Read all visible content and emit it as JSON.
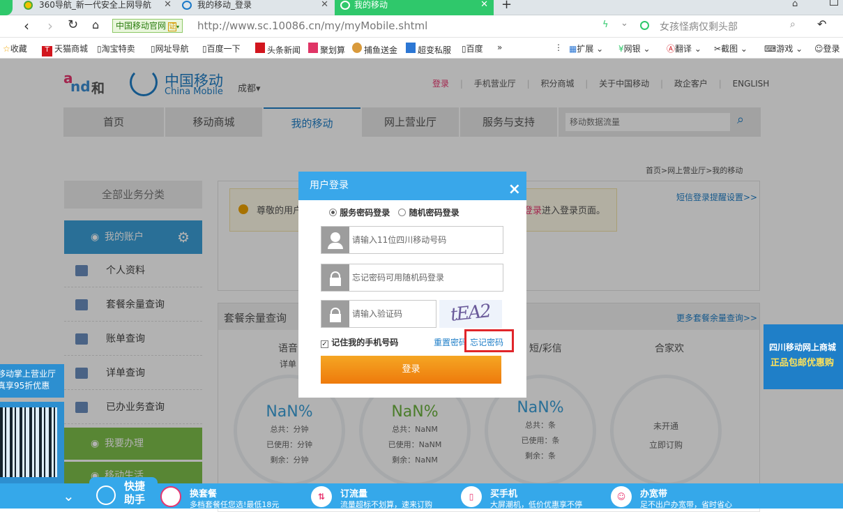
{
  "browser": {
    "tabs": [
      {
        "title": "360导航_新一代安全上网导航"
      },
      {
        "title": "我的移动_登录"
      },
      {
        "title": "我的移动"
      }
    ],
    "trusted_site_label": "中国移动官网",
    "cert_badge": "证",
    "url": "http://www.sc.10086.cn/my/myMobile.shtml",
    "search_text": "女孩怪病仅剩头部",
    "bookmarks": [
      "收藏",
      "天猫商城",
      "淘宝特卖",
      "网址导航",
      "百度一下",
      "头条新闻",
      "聚划算",
      "捕鱼送金",
      "超变私服",
      "百度"
    ],
    "more_bookmarks": "»",
    "tools": [
      "扩展",
      "网银",
      "翻译",
      "截图",
      "游戏",
      "登录"
    ]
  },
  "header": {
    "logo_he": "和",
    "logo_brand_cn": "中国移动",
    "logo_brand_en": "China Mobile",
    "city": "成都",
    "top_links": [
      "登录",
      "手机营业厅",
      "积分商城",
      "关于中国移动",
      "政企客户",
      "ENGLISH"
    ]
  },
  "nav": {
    "items": [
      "首页",
      "移动商城",
      "我的移动",
      "网上营业厅",
      "服务与支持"
    ],
    "search_placeholder": "移动数据流量"
  },
  "breadcrumb": "首页>网上营业厅>我的移动",
  "sidebar": {
    "category_title": "全部业务分类",
    "account_title": "我的账户",
    "items": [
      "个人资料",
      "套餐余量查询",
      "账单查询",
      "详单查询",
      "已办业务查询"
    ],
    "handle_title": "我要办理",
    "life_title": "移动生活"
  },
  "notice": {
    "text_start": "尊敬的用户",
    "link_text": "登录",
    "text_end": "进入登录页面。",
    "sms_reminder_link": "短信登录提醒设置>>"
  },
  "balance": {
    "title": "套餐余量查询",
    "more_link": "更多套餐余量查询>>",
    "columns": [
      "语音",
      "短/彩信",
      "合家欢"
    ],
    "voice_sub": "详单",
    "cards": [
      {
        "pct": "NaN%",
        "lines": [
          "总共：分钟",
          "已使用：分钟",
          "剩余：分钟"
        ],
        "color": "#3ba0d8"
      },
      {
        "pct": "NaN%",
        "lines": [
          "总共：NaNM",
          "已使用：NaNM",
          "剩余：NaNM"
        ],
        "color": "#6cb33e"
      },
      {
        "pct": "NaN%",
        "lines": [
          "总共：条",
          "已使用：条",
          "剩余：条"
        ],
        "color": "#3ba0d8"
      }
    ],
    "family": {
      "status": "未开通",
      "link": "立即订购"
    }
  },
  "left_promo": {
    "line1": "移动掌上营业厅",
    "line2": "真享95折优惠"
  },
  "right_promo": {
    "line1": "四川移动网上商城",
    "line2": "正品包邮优惠购"
  },
  "dialog": {
    "title": "用户登录",
    "close": "×",
    "radio_service": "服务密码登录",
    "radio_random": "随机密码登录",
    "phone_placeholder": "请输入11位四川移动号码",
    "password_placeholder": "忘记密码可用随机码登录",
    "captcha_placeholder": "请输入验证码",
    "captcha_text": "tEA2",
    "remember": "记住我的手机号码",
    "reset_password": "重置密码",
    "forgot_password": "忘记密码",
    "login_button": "登录"
  },
  "bottom": {
    "quick_label": "快捷助手",
    "items": [
      {
        "title": "换套餐",
        "desc": "多档套餐任您选!最低18元"
      },
      {
        "title": "订流量",
        "desc": "流量超标不划算，速来订购"
      },
      {
        "title": "买手机",
        "desc": "大屏潮机，低价优惠享不停"
      },
      {
        "title": "办宽带",
        "desc": "足不出户办宽带，省时省心"
      }
    ]
  },
  "colors": {
    "brand_blue": "#39a7ea",
    "login_orange": "#f08a12",
    "tab_green": "#2fc86b",
    "highlight_red": "#e0252a"
  }
}
